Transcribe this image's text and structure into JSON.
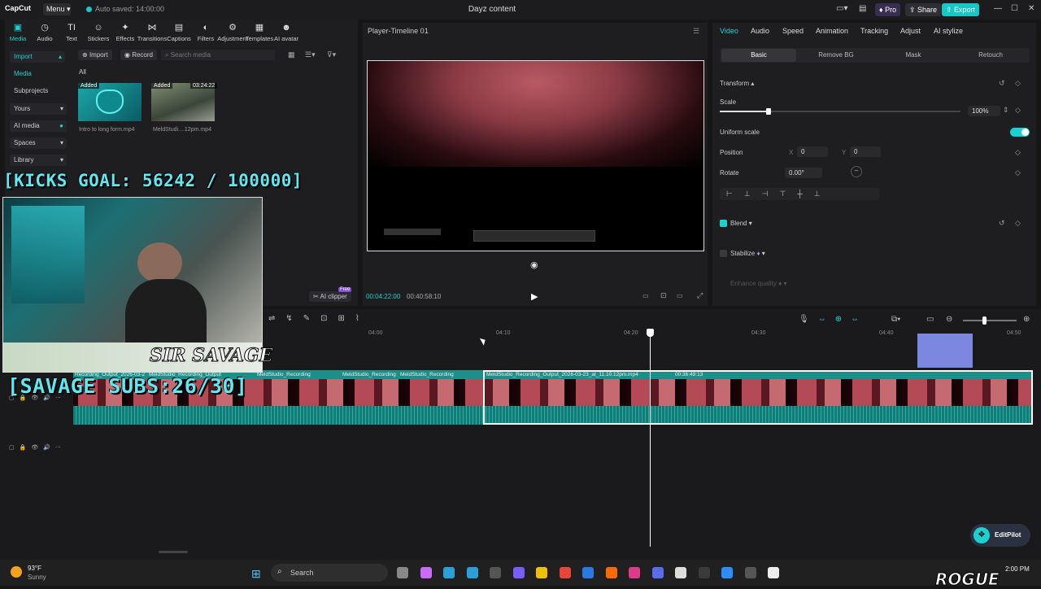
{
  "titlebar": {
    "logo": "CapCut",
    "menu": "Menu",
    "autosave": "Auto saved: 14:00:00",
    "title": "Dayz content",
    "pro": "Pro",
    "share": "Share",
    "export": "Export"
  },
  "toolbar": [
    {
      "label": "Media",
      "icon": "media-icon",
      "glyph": "▣",
      "active": true
    },
    {
      "label": "Audio",
      "icon": "audio-icon",
      "glyph": "◷"
    },
    {
      "label": "Text",
      "icon": "text-icon",
      "glyph": "TI"
    },
    {
      "label": "Stickers",
      "icon": "sticker-icon",
      "glyph": "☺"
    },
    {
      "label": "Effects",
      "icon": "effects-icon",
      "glyph": "✦"
    },
    {
      "label": "Transitions",
      "icon": "transitions-icon",
      "glyph": "⋈"
    },
    {
      "label": "Captions",
      "icon": "captions-icon",
      "glyph": "▤"
    },
    {
      "label": "Filters",
      "icon": "filters-icon",
      "glyph": "◐"
    },
    {
      "label": "Adjustment",
      "icon": "adjustment-icon",
      "glyph": "⚙"
    },
    {
      "label": "Templates",
      "icon": "templates-icon",
      "glyph": "▦"
    },
    {
      "label": "AI avatar",
      "icon": "ai-avatar-icon",
      "glyph": "☻"
    }
  ],
  "nav": {
    "import": "Import",
    "media": "Media",
    "subprojects": "Subprojects",
    "yours": "Yours",
    "ai_media": "AI media",
    "spaces": "Spaces",
    "library": "Library"
  },
  "media_panel": {
    "import_btn": "Import",
    "record_btn": "Record",
    "search_placeholder": "Search media",
    "filter_all": "All",
    "items": [
      {
        "name": "Intro to long form.mp4",
        "badge": "Added",
        "duration": ""
      },
      {
        "name": "MeldStudi....12pm.mp4",
        "badge": "Added",
        "duration": "03:24:22"
      }
    ],
    "ai_clipper": "AI clipper",
    "free_badge": "Free"
  },
  "player": {
    "title": "Player-Timeline 01",
    "current_time": "00:04:22:00",
    "total_time": "00:40:58:10"
  },
  "right_panel": {
    "tabs": [
      "Video",
      "Audio",
      "Speed",
      "Animation",
      "Tracking",
      "Adjust",
      "AI stylize"
    ],
    "subtabs": [
      "Basic",
      "Remove BG",
      "Mask",
      "Retouch"
    ],
    "transform": "Transform",
    "scale_label": "Scale",
    "scale_value": "100%",
    "scale_level": 0.5,
    "uniform_scale": "Uniform scale",
    "position_label": "Position",
    "pos_x_label": "X",
    "pos_x": "0",
    "pos_y_label": "Y",
    "pos_y": "0",
    "rotate_label": "Rotate",
    "rotate_value": "0.00°",
    "blend": "Blend",
    "stabilize": "Stabilize",
    "enhance": "Enhance quality"
  },
  "overlays": {
    "kicks_goal": "[KICKS GOAL: 56242 / 100000]",
    "savage_subs": "[SAVAGE SUBS:26/30]",
    "sir_savage": "SIR SAVAGE"
  },
  "timeline": {
    "ruler": [
      "04:00",
      "04:10",
      "04:20",
      "04:30",
      "04:40",
      "04:50"
    ],
    "clips": [
      "Recording_Output_2026-03-2",
      "MeldStudio_Recording_Output",
      "MeldStudio_Recording",
      "MeldStudio_Recording",
      "MeldStudio_Recording",
      "MeldStudio_Recording_Output_2026-03-23_at_11.10.12pm.mp4"
    ],
    "main_clip_duration": "00:36:49:13"
  },
  "editpilot": "EditPilot",
  "taskbar": {
    "weather_temp": "93°F",
    "weather_desc": "Sunny",
    "search": "Search",
    "time": "2:00 PM",
    "brand": "ROGUE"
  },
  "colors": {
    "accent": "#1ed1d1",
    "overlay": "#5ee8f0",
    "clip": "#1b8f8a"
  }
}
